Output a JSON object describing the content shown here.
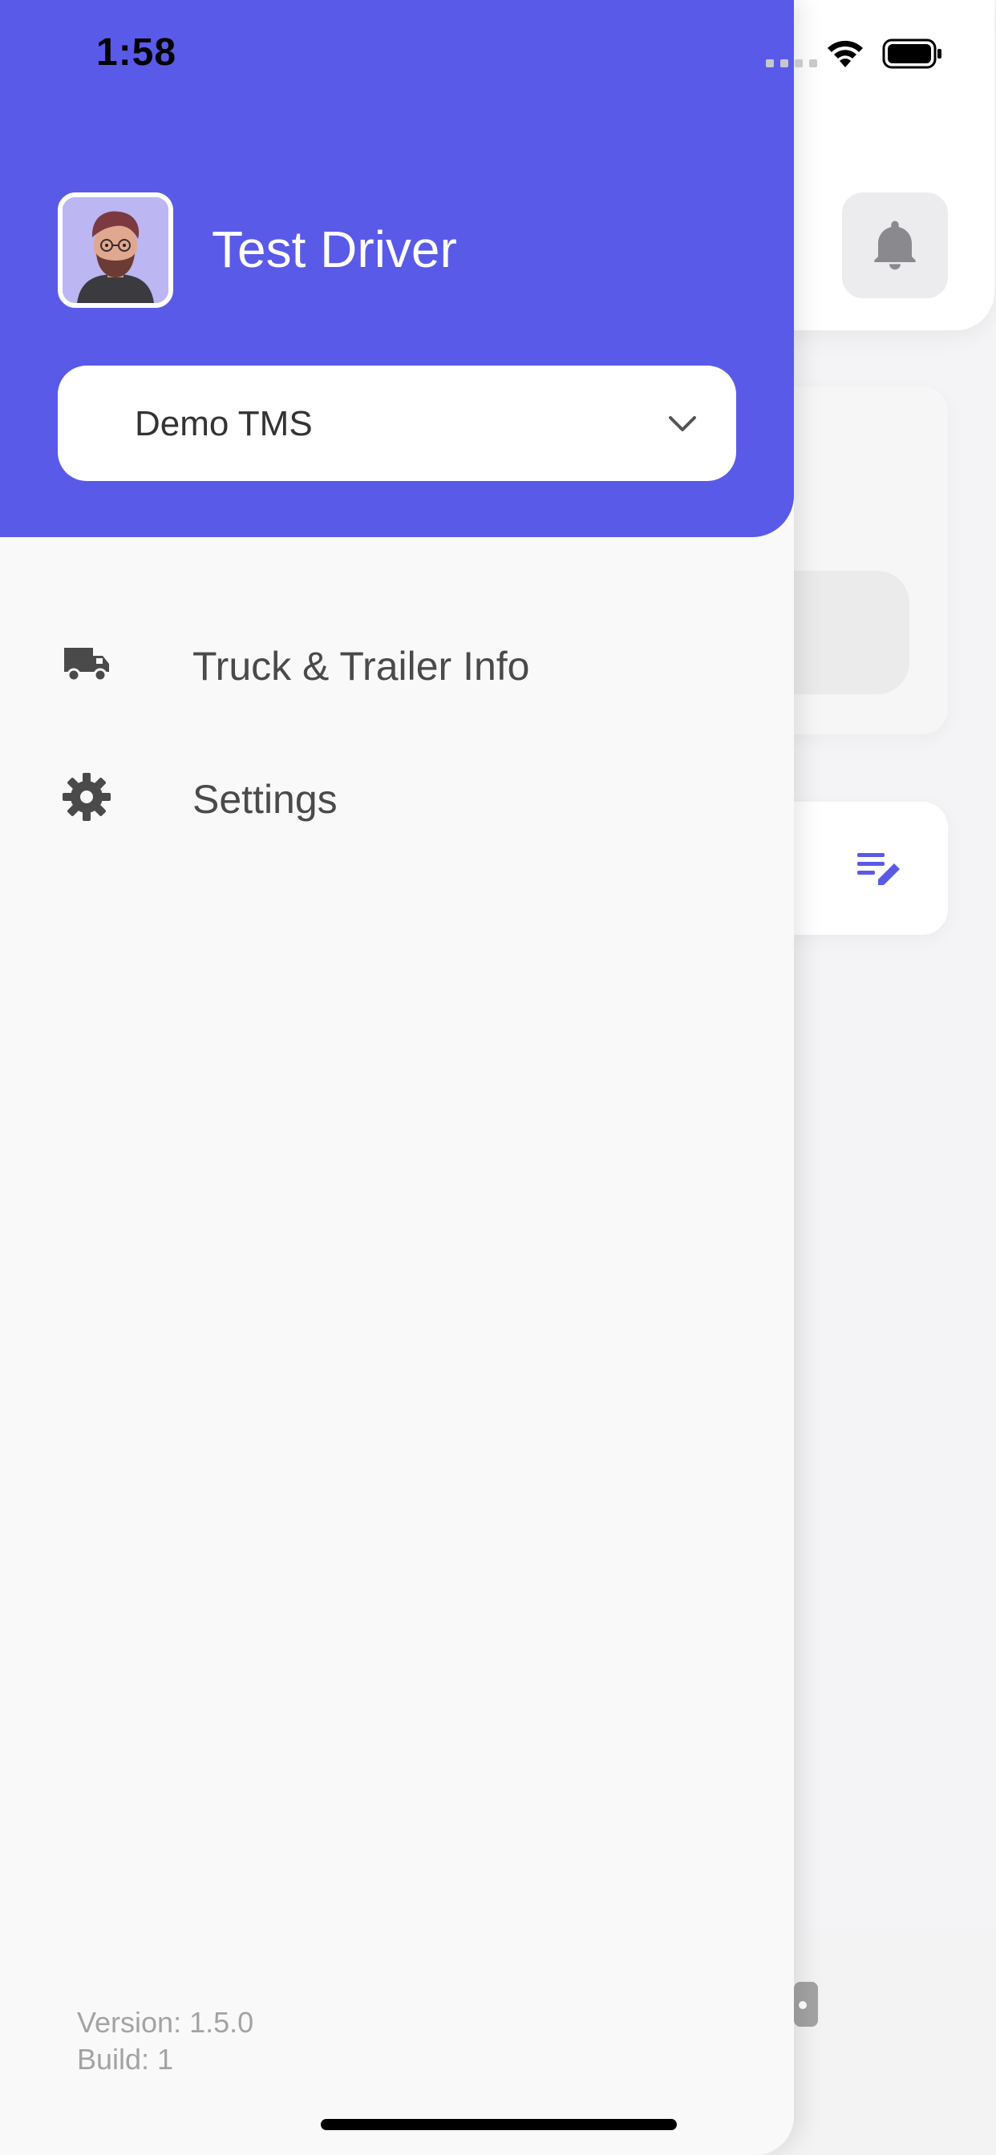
{
  "status_bar": {
    "time": "1:58"
  },
  "drawer": {
    "user_name": "Test Driver",
    "company_select": {
      "value": "Demo TMS"
    },
    "menu": [
      {
        "label": "Truck & Trailer Info",
        "icon": "truck-icon"
      },
      {
        "label": "Settings",
        "icon": "gear-icon"
      }
    ],
    "version_line": "Version: 1.5.0",
    "build_line": "Build: 1"
  },
  "colors": {
    "primary": "#5a5ae8",
    "drawer_bg": "#f9f9f9",
    "text_dark": "#4a4a4a",
    "muted": "#a3a3a3"
  }
}
